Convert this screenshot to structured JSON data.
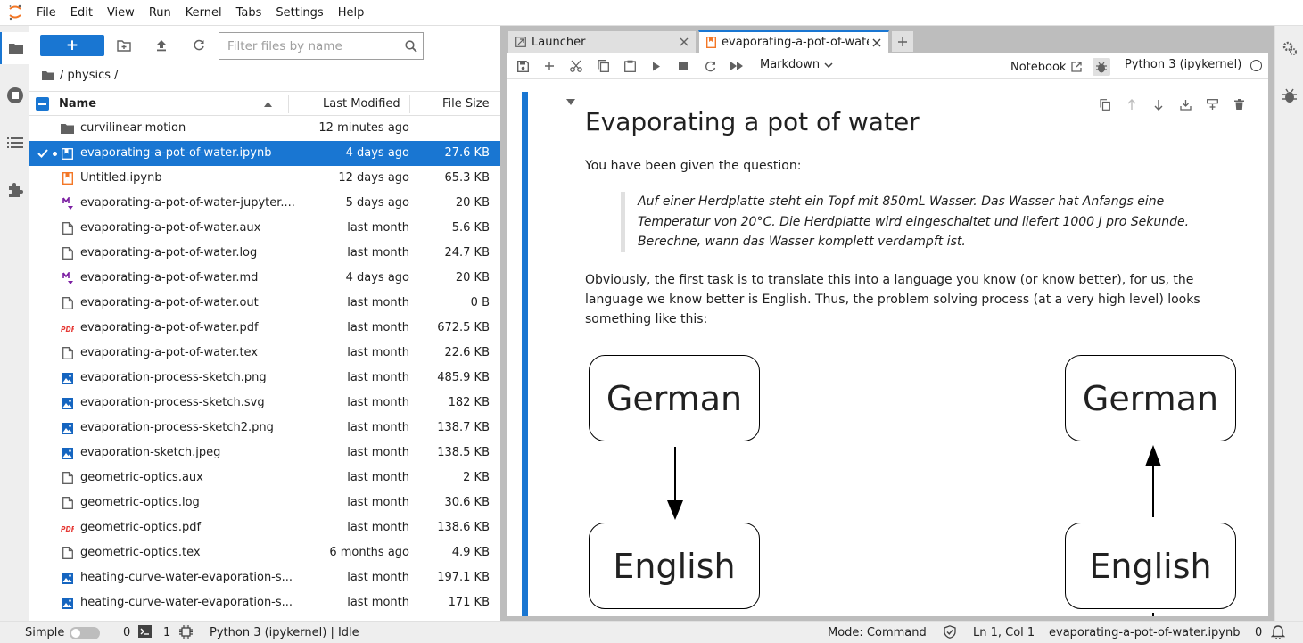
{
  "menubar": {
    "items": [
      "File",
      "Edit",
      "View",
      "Run",
      "Kernel",
      "Tabs",
      "Settings",
      "Help"
    ]
  },
  "filebrowser": {
    "new_label": "+",
    "filter_placeholder": "Filter files by name",
    "breadcrumb": "/ physics /",
    "columns": {
      "name": "Name",
      "modified": "Last Modified",
      "size": "File Size"
    },
    "files": [
      {
        "name": "curvilinear-motion",
        "modified": "12 minutes ago",
        "size": "",
        "icon": "folder-icon",
        "selected": false
      },
      {
        "name": "evaporating-a-pot-of-water.ipynb",
        "modified": "4 days ago",
        "size": "27.6 KB",
        "icon": "notebook-icon",
        "selected": true
      },
      {
        "name": "Untitled.ipynb",
        "modified": "12 days ago",
        "size": "65.3 KB",
        "icon": "notebook-icon",
        "selected": false
      },
      {
        "name": "evaporating-a-pot-of-water-jupyter....",
        "modified": "5 days ago",
        "size": "20 KB",
        "icon": "markdown-icon",
        "selected": false
      },
      {
        "name": "evaporating-a-pot-of-water.aux",
        "modified": "last month",
        "size": "5.6 KB",
        "icon": "file-icon",
        "selected": false
      },
      {
        "name": "evaporating-a-pot-of-water.log",
        "modified": "last month",
        "size": "24.7 KB",
        "icon": "file-icon",
        "selected": false
      },
      {
        "name": "evaporating-a-pot-of-water.md",
        "modified": "4 days ago",
        "size": "20 KB",
        "icon": "markdown-icon",
        "selected": false
      },
      {
        "name": "evaporating-a-pot-of-water.out",
        "modified": "last month",
        "size": "0 B",
        "icon": "file-icon",
        "selected": false
      },
      {
        "name": "evaporating-a-pot-of-water.pdf",
        "modified": "last month",
        "size": "672.5 KB",
        "icon": "pdf-icon",
        "selected": false
      },
      {
        "name": "evaporating-a-pot-of-water.tex",
        "modified": "last month",
        "size": "22.6 KB",
        "icon": "file-icon",
        "selected": false
      },
      {
        "name": "evaporation-process-sketch.png",
        "modified": "last month",
        "size": "485.9 KB",
        "icon": "image-icon",
        "selected": false
      },
      {
        "name": "evaporation-process-sketch.svg",
        "modified": "last month",
        "size": "182 KB",
        "icon": "image-icon",
        "selected": false
      },
      {
        "name": "evaporation-process-sketch2.png",
        "modified": "last month",
        "size": "138.7 KB",
        "icon": "image-icon",
        "selected": false
      },
      {
        "name": "evaporation-sketch.jpeg",
        "modified": "last month",
        "size": "138.5 KB",
        "icon": "image-icon",
        "selected": false
      },
      {
        "name": "geometric-optics.aux",
        "modified": "last month",
        "size": "2 KB",
        "icon": "file-icon",
        "selected": false
      },
      {
        "name": "geometric-optics.log",
        "modified": "last month",
        "size": "30.6 KB",
        "icon": "file-icon",
        "selected": false
      },
      {
        "name": "geometric-optics.pdf",
        "modified": "last month",
        "size": "138.6 KB",
        "icon": "pdf-icon",
        "selected": false
      },
      {
        "name": "geometric-optics.tex",
        "modified": "6 months ago",
        "size": "4.9 KB",
        "icon": "file-icon",
        "selected": false
      },
      {
        "name": "heating-curve-water-evaporation-s...",
        "modified": "last month",
        "size": "197.1 KB",
        "icon": "image-icon",
        "selected": false
      },
      {
        "name": "heating-curve-water-evaporation-s...",
        "modified": "last month",
        "size": "171 KB",
        "icon": "image-icon",
        "selected": false
      }
    ]
  },
  "tabs": [
    {
      "label": "Launcher",
      "icon": "launcher-icon"
    },
    {
      "label": "evaporating-a-pot-of-watе",
      "icon": "notebook-icon"
    }
  ],
  "notebook_toolbar": {
    "cell_type": "Markdown",
    "notebook_label": "Notebook",
    "kernel": "Python 3 (ipykernel)"
  },
  "cell": {
    "heading": "Evaporating a pot of water",
    "p1": "You have been given the question:",
    "quote": "Auf einer Herdplatte steht ein Topf mit 850mL Wasser. Das Wasser hat Anfangs eine Temperatur von 20°C. Die Herdplatte wird eingeschaltet und liefert 1000 J pro Sekunde. Berechne, wann das Wasser komplett verdampft ist.",
    "p2": "Obviously, the first task is to translate this into a language you know (or know better), for us, the language we know better is English. Thus, the problem solving process (at a very high level) looks something like this:",
    "diagram": {
      "top_left": "German",
      "top_right": "German",
      "bottom_left": "English",
      "bottom_right": "English"
    }
  },
  "statusbar": {
    "mode_simple": "Simple",
    "terminals": "0",
    "kernels": "1",
    "kernel_status": "Python 3 (ipykernel) | Idle",
    "mode": "Mode: Command",
    "position": "Ln 1, Col 1",
    "filename": "evaporating-a-pot-of-water.ipynb",
    "notifications": "0"
  },
  "colors": {
    "accent": "#1976d2",
    "selected_row": "#1976d2",
    "background_grey": "#bdbdbd"
  }
}
